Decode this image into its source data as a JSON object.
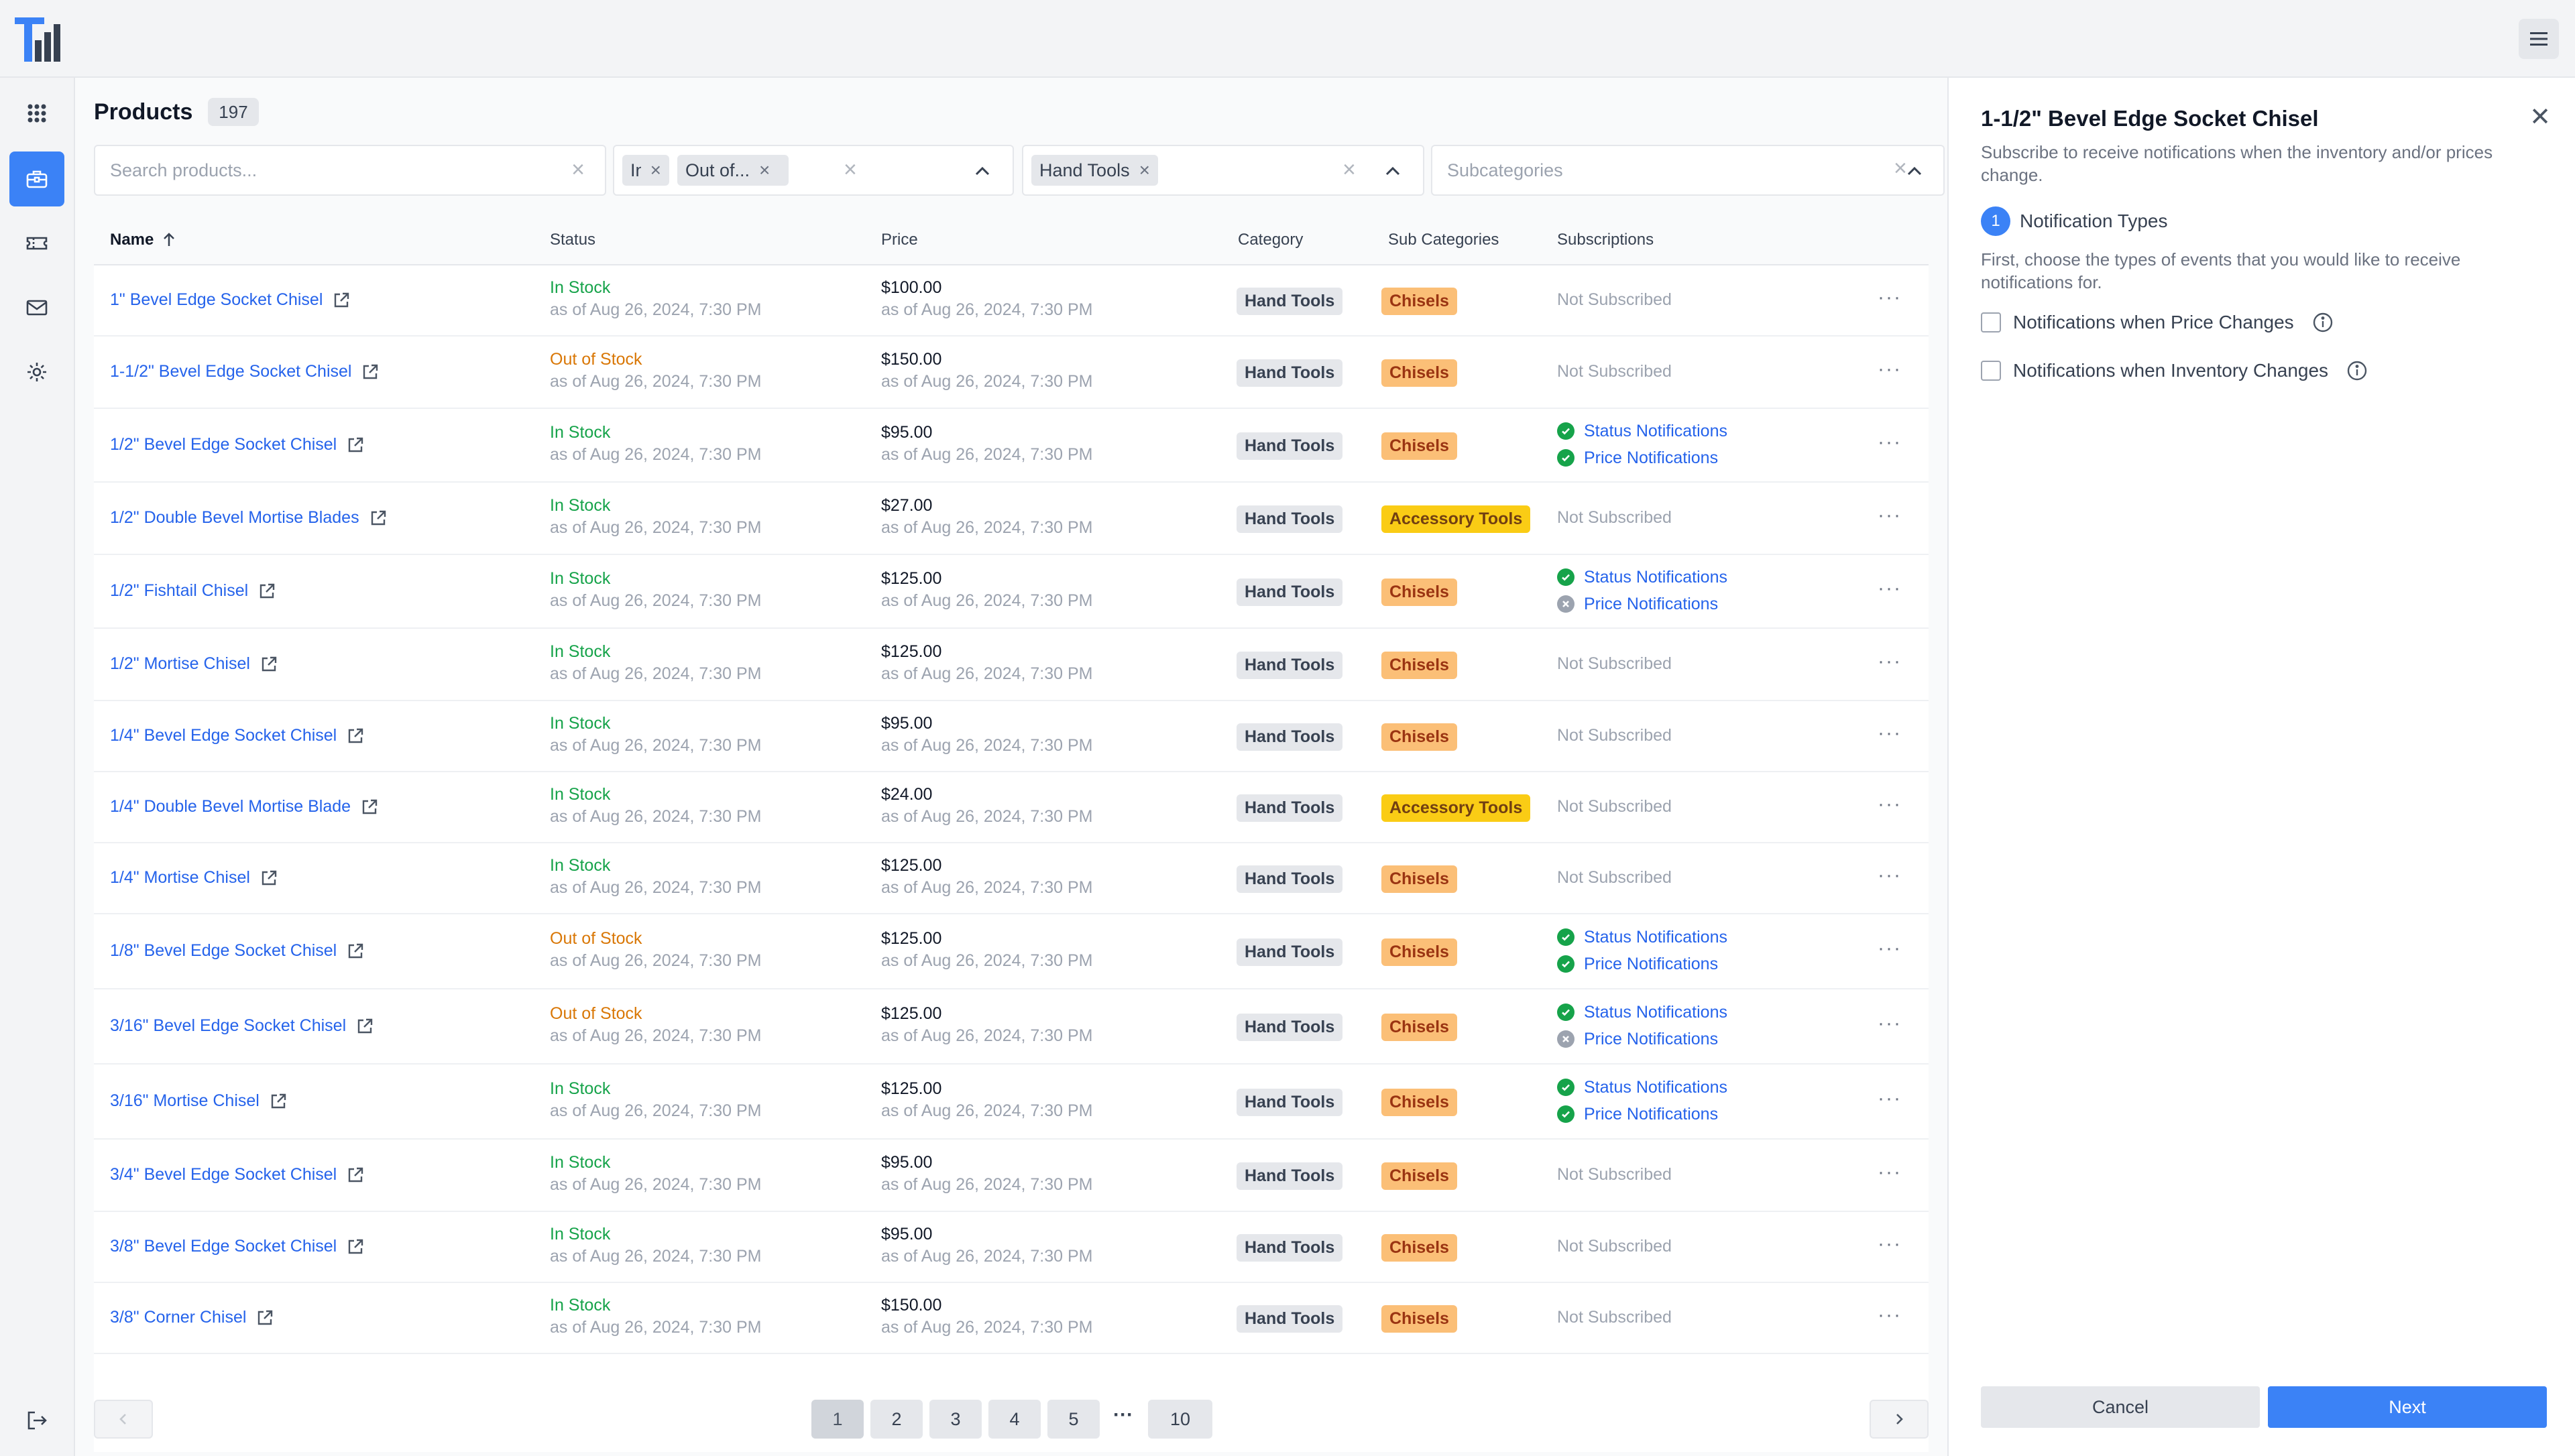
{
  "header": {
    "logo_icon": "app-logo",
    "menu_icon": "hamburger-icon"
  },
  "sidebar": {
    "items": [
      {
        "icon": "apps-grid-icon",
        "active": false
      },
      {
        "icon": "toolbox-icon",
        "active": true
      },
      {
        "icon": "ticket-icon",
        "active": false
      },
      {
        "icon": "mail-icon",
        "active": false
      },
      {
        "icon": "gear-icon",
        "active": false
      }
    ],
    "logout_icon": "logout-icon"
  },
  "main": {
    "title": "Products",
    "count": "197",
    "search_placeholder": "Search products...",
    "status_chips": [
      "In ...",
      "Out of..."
    ],
    "category_chip": "Hand Tools",
    "subcategories_placeholder": "Subcategories"
  },
  "table": {
    "headers": {
      "name": "Name",
      "status": "Status",
      "price": "Price",
      "category": "Category",
      "subcategories": "Sub Categories",
      "subscriptions": "Subscriptions"
    },
    "rows": [
      {
        "name": "1\" Bevel Edge Socket Chisel",
        "status": "In Stock",
        "status_type": "in",
        "asof": "as of Aug 26, 2024, 7:30 PM",
        "price": "$100.00",
        "category": "Hand Tools",
        "sub": "Chisels",
        "sub_type": "sub",
        "subs": []
      },
      {
        "name": "1-1/2\" Bevel Edge Socket Chisel",
        "status": "Out of Stock",
        "status_type": "out",
        "asof": "as of Aug 26, 2024, 7:30 PM",
        "price": "$150.00",
        "category": "Hand Tools",
        "sub": "Chisels",
        "sub_type": "sub",
        "subs": []
      },
      {
        "name": "1/2\" Bevel Edge Socket Chisel",
        "status": "In Stock",
        "status_type": "in",
        "asof": "as of Aug 26, 2024, 7:30 PM",
        "price": "$95.00",
        "category": "Hand Tools",
        "sub": "Chisels",
        "sub_type": "sub",
        "subs": [
          {
            "label": "Status Notifications",
            "ok": true
          },
          {
            "label": "Price Notifications",
            "ok": true
          }
        ]
      },
      {
        "name": "1/2\" Double Bevel Mortise Blades",
        "status": "In Stock",
        "status_type": "in",
        "asof": "as of Aug 26, 2024, 7:30 PM",
        "price": "$27.00",
        "category": "Hand Tools",
        "sub": "Accessory Tools",
        "sub_type": "acc",
        "subs": []
      },
      {
        "name": "1/2\" Fishtail Chisel",
        "status": "In Stock",
        "status_type": "in",
        "asof": "as of Aug 26, 2024, 7:30 PM",
        "price": "$125.00",
        "category": "Hand Tools",
        "sub": "Chisels",
        "sub_type": "sub",
        "subs": [
          {
            "label": "Status Notifications",
            "ok": true
          },
          {
            "label": "Price Notifications",
            "ok": false
          }
        ]
      },
      {
        "name": "1/2\" Mortise Chisel",
        "status": "In Stock",
        "status_type": "in",
        "asof": "as of Aug 26, 2024, 7:30 PM",
        "price": "$125.00",
        "category": "Hand Tools",
        "sub": "Chisels",
        "sub_type": "sub",
        "subs": []
      },
      {
        "name": "1/4\" Bevel Edge Socket Chisel",
        "status": "In Stock",
        "status_type": "in",
        "asof": "as of Aug 26, 2024, 7:30 PM",
        "price": "$95.00",
        "category": "Hand Tools",
        "sub": "Chisels",
        "sub_type": "sub",
        "subs": []
      },
      {
        "name": "1/4\" Double Bevel Mortise Blade",
        "status": "In Stock",
        "status_type": "in",
        "asof": "as of Aug 26, 2024, 7:30 PM",
        "price": "$24.00",
        "category": "Hand Tools",
        "sub": "Accessory Tools",
        "sub_type": "acc",
        "subs": []
      },
      {
        "name": "1/4\" Mortise Chisel",
        "status": "In Stock",
        "status_type": "in",
        "asof": "as of Aug 26, 2024, 7:30 PM",
        "price": "$125.00",
        "category": "Hand Tools",
        "sub": "Chisels",
        "sub_type": "sub",
        "subs": []
      },
      {
        "name": "1/8\" Bevel Edge Socket Chisel",
        "status": "Out of Stock",
        "status_type": "out",
        "asof": "as of Aug 26, 2024, 7:30 PM",
        "price": "$125.00",
        "category": "Hand Tools",
        "sub": "Chisels",
        "sub_type": "sub",
        "subs": [
          {
            "label": "Status Notifications",
            "ok": true
          },
          {
            "label": "Price Notifications",
            "ok": true
          }
        ]
      },
      {
        "name": "3/16\" Bevel Edge Socket Chisel",
        "status": "Out of Stock",
        "status_type": "out",
        "asof": "as of Aug 26, 2024, 7:30 PM",
        "price": "$125.00",
        "category": "Hand Tools",
        "sub": "Chisels",
        "sub_type": "sub",
        "subs": [
          {
            "label": "Status Notifications",
            "ok": true
          },
          {
            "label": "Price Notifications",
            "ok": false
          }
        ]
      },
      {
        "name": "3/16\" Mortise Chisel",
        "status": "In Stock",
        "status_type": "in",
        "asof": "as of Aug 26, 2024, 7:30 PM",
        "price": "$125.00",
        "category": "Hand Tools",
        "sub": "Chisels",
        "sub_type": "sub",
        "subs": [
          {
            "label": "Status Notifications",
            "ok": true
          },
          {
            "label": "Price Notifications",
            "ok": true
          }
        ]
      },
      {
        "name": "3/4\" Bevel Edge Socket Chisel",
        "status": "In Stock",
        "status_type": "in",
        "asof": "as of Aug 26, 2024, 7:30 PM",
        "price": "$95.00",
        "category": "Hand Tools",
        "sub": "Chisels",
        "sub_type": "sub",
        "subs": []
      },
      {
        "name": "3/8\" Bevel Edge Socket Chisel",
        "status": "In Stock",
        "status_type": "in",
        "asof": "as of Aug 26, 2024, 7:30 PM",
        "price": "$95.00",
        "category": "Hand Tools",
        "sub": "Chisels",
        "sub_type": "sub",
        "subs": []
      },
      {
        "name": "3/8\" Corner Chisel",
        "status": "In Stock",
        "status_type": "in",
        "asof": "as of Aug 26, 2024, 7:30 PM",
        "price": "$150.00",
        "category": "Hand Tools",
        "sub": "Chisels",
        "sub_type": "sub",
        "subs": []
      }
    ],
    "not_subscribed": "Not Subscribed",
    "more_label": "···"
  },
  "pagination": {
    "pages": [
      "1",
      "2",
      "3",
      "4",
      "5"
    ],
    "ellipsis": "···",
    "last": "10",
    "current": "1",
    "prev_icon": "chevron-left-icon",
    "next_icon": "chevron-right-icon"
  },
  "panel": {
    "title": "1-1/2\" Bevel Edge Socket Chisel",
    "subtitle": "Subscribe to receive notifications when the inventory and/or prices change.",
    "step_number": "1",
    "step_label": "Notification Types",
    "step_desc": "First, choose the types of events that you would like to receive notifications for.",
    "options": [
      "Notifications when Price Changes",
      "Notifications when Inventory Changes"
    ],
    "cancel": "Cancel",
    "next": "Next"
  },
  "colors": {
    "accent": "#3b82f6",
    "link": "#2563eb",
    "in_stock": "#16a34a",
    "out_of_stock": "#d97706",
    "chisels_tag": "#fbbf77",
    "accessory_tag": "#facc15"
  }
}
